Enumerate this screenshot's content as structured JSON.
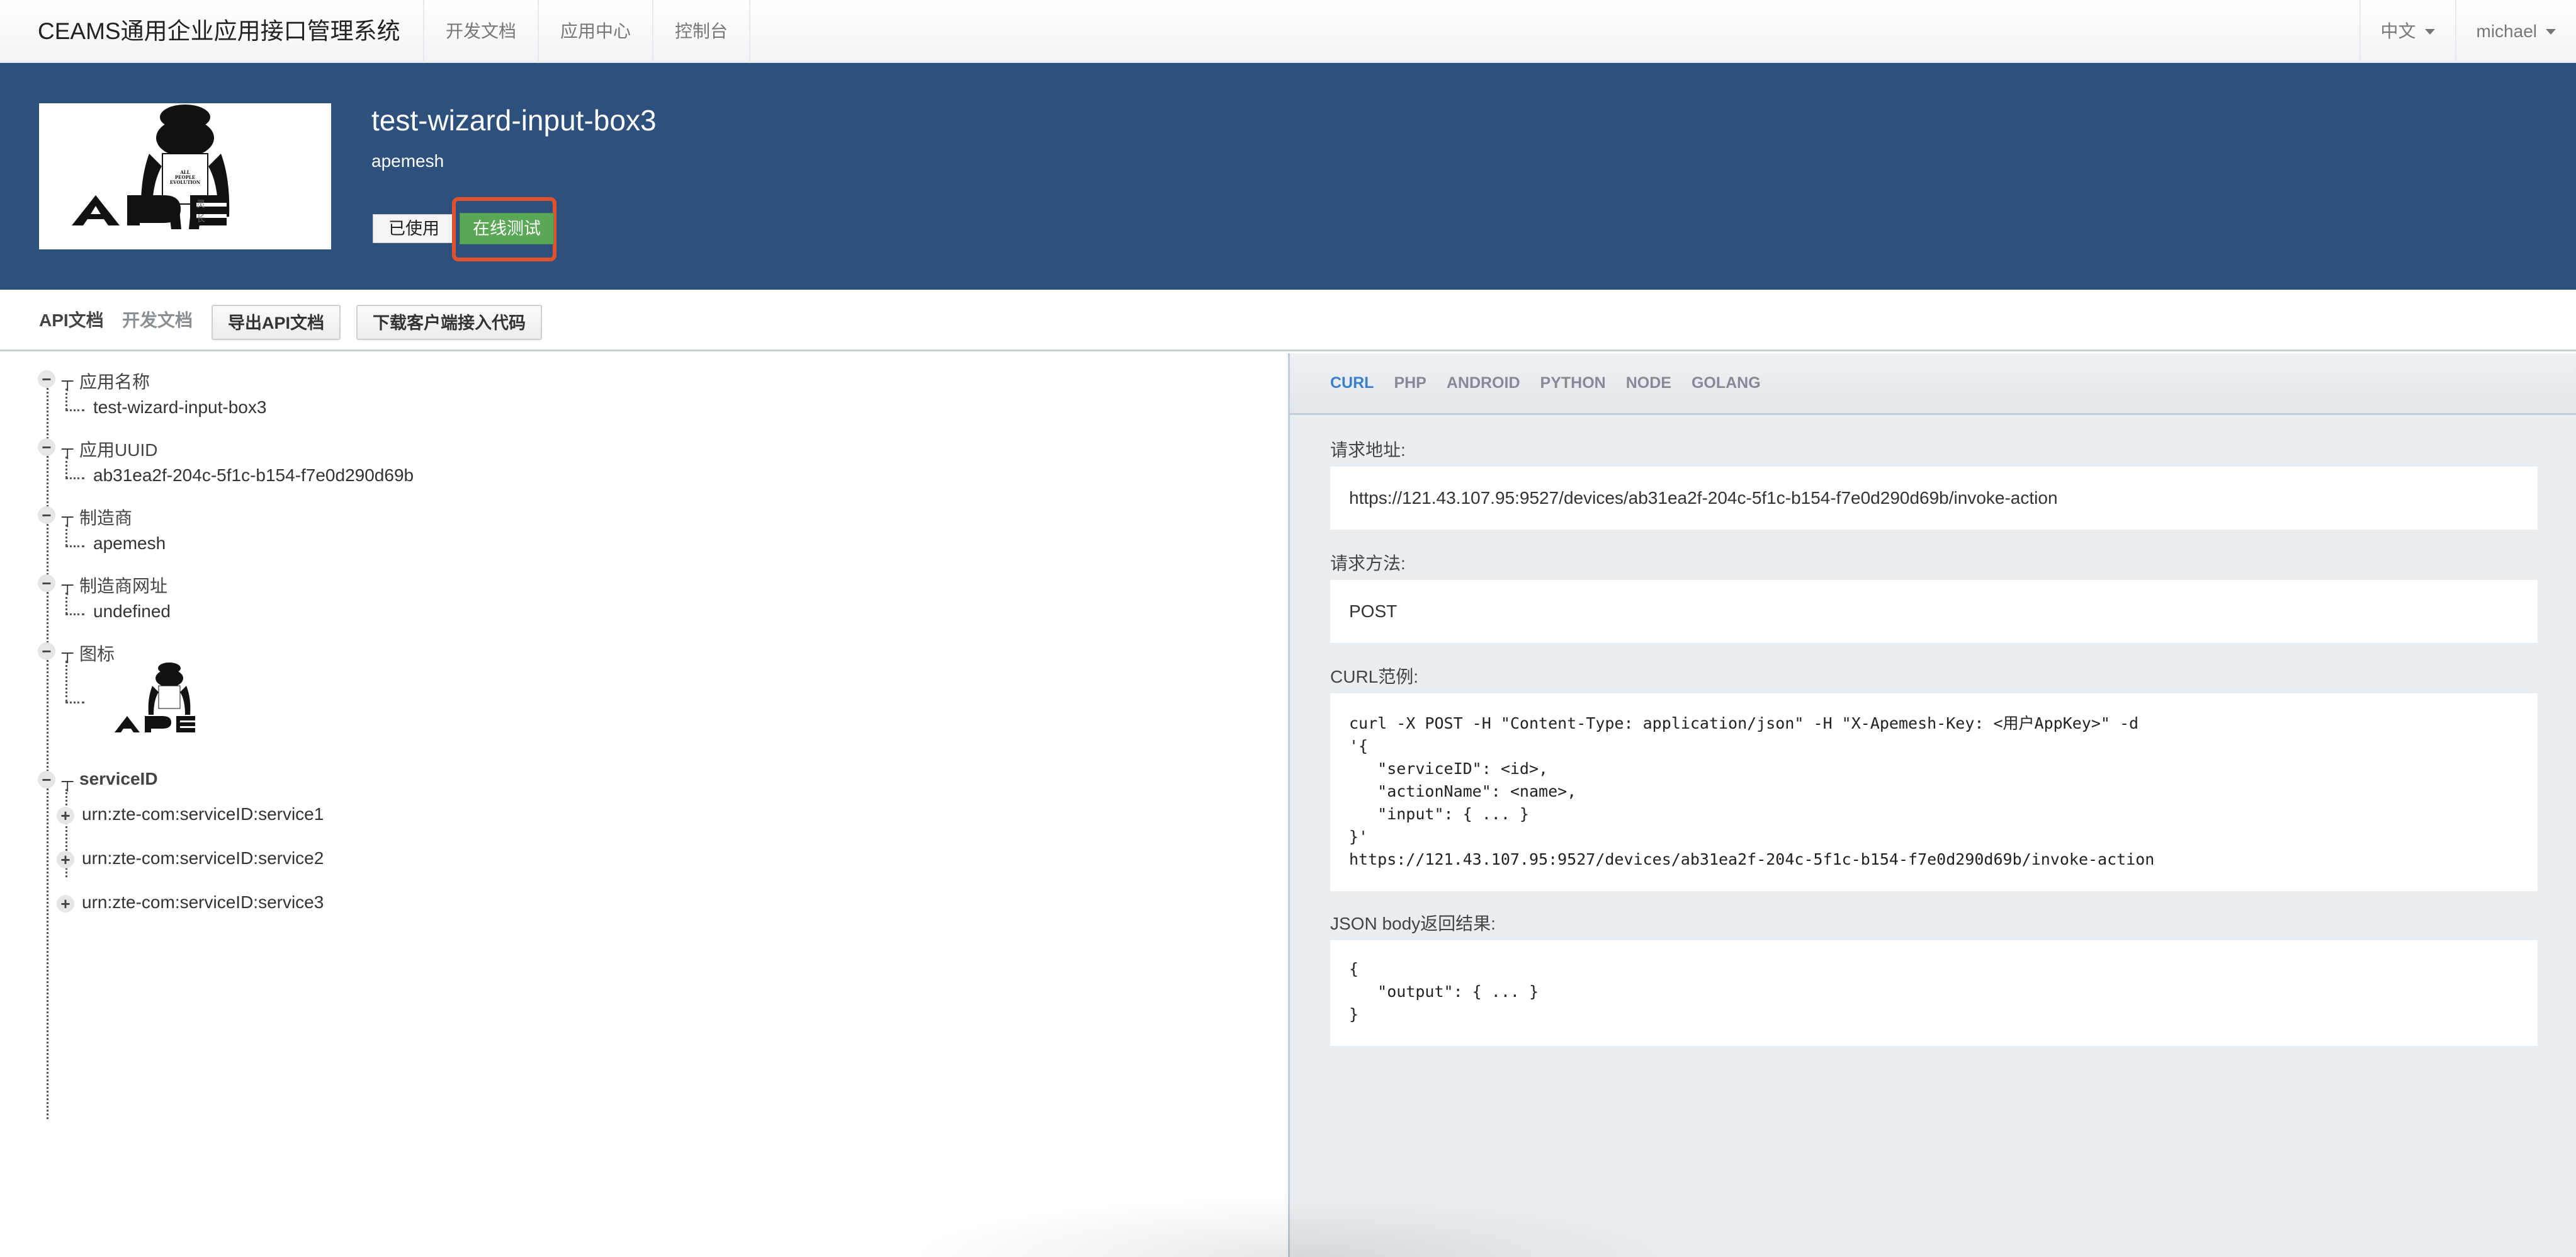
{
  "navbar": {
    "brand": "CEAMS通用企业应用接口管理系统",
    "links": [
      {
        "label": "开发文档"
      },
      {
        "label": "应用中心"
      },
      {
        "label": "控制台"
      }
    ],
    "language": "中文",
    "user": "michael"
  },
  "hero": {
    "logo_icon": "ape-logo",
    "logo_text": "APE",
    "logo_subtext": "ALL PEOPLE EVOLUTION",
    "app_title": "test-wizard-input-box3",
    "vendor": "apemesh",
    "used_label": "已使用",
    "test_label": "在线测试",
    "highlight_color": "#e2512b",
    "test_color": "#5aa856",
    "bg_color": "#2e507c"
  },
  "subbar": {
    "tab_api": "API文档",
    "tab_dev": "开发文档",
    "export_label": "导出API文档",
    "download_label": "下载客户端接入代码"
  },
  "tree": {
    "nodes": [
      {
        "label": "应用名称",
        "value": "test-wizard-input-box3"
      },
      {
        "label": "应用UUID",
        "value": "ab31ea2f-204c-5f1c-b154-f7e0d290d69b"
      },
      {
        "label": "制造商",
        "value": "apemesh"
      },
      {
        "label": "制造商网址",
        "value": "undefined"
      },
      {
        "label": "图标",
        "value": "ape-logo-image"
      }
    ],
    "service_root": "serviceID",
    "services": [
      {
        "label": "urn:zte-com:serviceID:service1"
      },
      {
        "label": "urn:zte-com:serviceID:service2"
      },
      {
        "label": "urn:zte-com:serviceID:service3"
      }
    ],
    "collapse_glyph": "−",
    "expand_glyph": "+"
  },
  "code_panel": {
    "tabs": [
      {
        "label": "CURL",
        "active": true
      },
      {
        "label": "PHP"
      },
      {
        "label": "ANDROID"
      },
      {
        "label": "PYTHON"
      },
      {
        "label": "NODE"
      },
      {
        "label": "GOLANG"
      }
    ],
    "active_color": "#3a7fc8",
    "url_label": "请求地址:",
    "url_value": "https://121.43.107.95:9527/devices/ab31ea2f-204c-5f1c-b154-f7e0d290d69b/invoke-action",
    "method_label": "请求方法:",
    "method_value": "POST",
    "curl_label": "CURL范例:",
    "curl_code": "curl -X POST -H \"Content-Type: application/json\" -H \"X-Apemesh-Key: <用户AppKey>\" -d\n'{\n   \"serviceID\": <id>,\n   \"actionName\": <name>,\n   \"input\": { ... }\n}'\nhttps://121.43.107.95:9527/devices/ab31ea2f-204c-5f1c-b154-f7e0d290d69b/invoke-action",
    "json_label": "JSON body返回结果:",
    "json_code": "{\n   \"output\": { ... }\n}"
  }
}
